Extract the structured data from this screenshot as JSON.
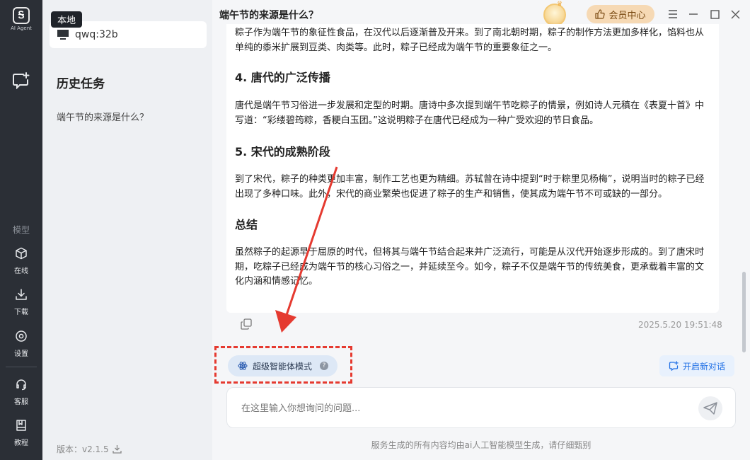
{
  "rail": {
    "logo_text": "AI Agent",
    "model_section_label": "模型",
    "items": [
      {
        "label": "在线",
        "icon": "cube-icon"
      },
      {
        "label": "下载",
        "icon": "download-icon"
      },
      {
        "label": "设置",
        "icon": "settings-icon"
      },
      {
        "label": "客服",
        "icon": "headset-icon"
      },
      {
        "label": "教程",
        "icon": "book-icon"
      }
    ]
  },
  "history": {
    "tooltip": "本地",
    "model_name": "qwq:32b",
    "title": "历史任务",
    "items": [
      "端午节的来源是什么？"
    ],
    "version": "版本：v2.1.5"
  },
  "header": {
    "title": "端午节的来源是什么？",
    "vip_label": "会员中心"
  },
  "article": {
    "p_top": "粽子作为端午节的象征性食品，在汉代以后逐渐普及开来。到了南北朝时期，粽子的制作方法更加多样化，馅料也从单纯的黍米扩展到豆类、肉类等。此时，粽子已经成为端午节的重要象征之一。",
    "h4": "4. 唐代的广泛传播",
    "p4": "唐代是端午节习俗进一步发展和定型的时期。唐诗中多次提到端午节吃粽子的情景，例如诗人元稹在《表夏十首》中写道：“彩缕碧筠粽，香粳白玉团。”这说明粽子在唐代已经成为一种广受欢迎的节日食品。",
    "h5": "5. 宋代的成熟阶段",
    "p5": "到了宋代，粽子的种类更加丰富，制作工艺也更为精细。苏轼曾在诗中提到“时于粽里见杨梅”，说明当时的粽子已经出现了多种口味。此外，宋代的商业繁荣也促进了粽子的生产和销售，使其成为端午节不可或缺的一部分。",
    "h_summary": "总结",
    "p_summary": "虽然粽子的起源早于屈原的时代，但将其与端午节结合起来并广泛流行，可能是从汉代开始逐步形成的。到了唐宋时期，吃粽子已经成为端午节的核心习俗之一，并延续至今。如今，粽子不仅是端午节的传统美食，更承载着丰富的文化内涵和情感记忆。"
  },
  "message": {
    "timestamp": "2025.5.20 19:51:48"
  },
  "composer": {
    "mode_label": "超级智能体模式",
    "help": "?",
    "new_conversation": "开启新对话",
    "placeholder": "在这里输入你想询问的问题...",
    "disclaimer": "服务生成的所有内容均由ai人工智能模型生成，请仔细甄别"
  },
  "colors": {
    "annotation": "#e53a30",
    "accent": "#1f6fe5",
    "rail_bg": "#2b2f36"
  }
}
